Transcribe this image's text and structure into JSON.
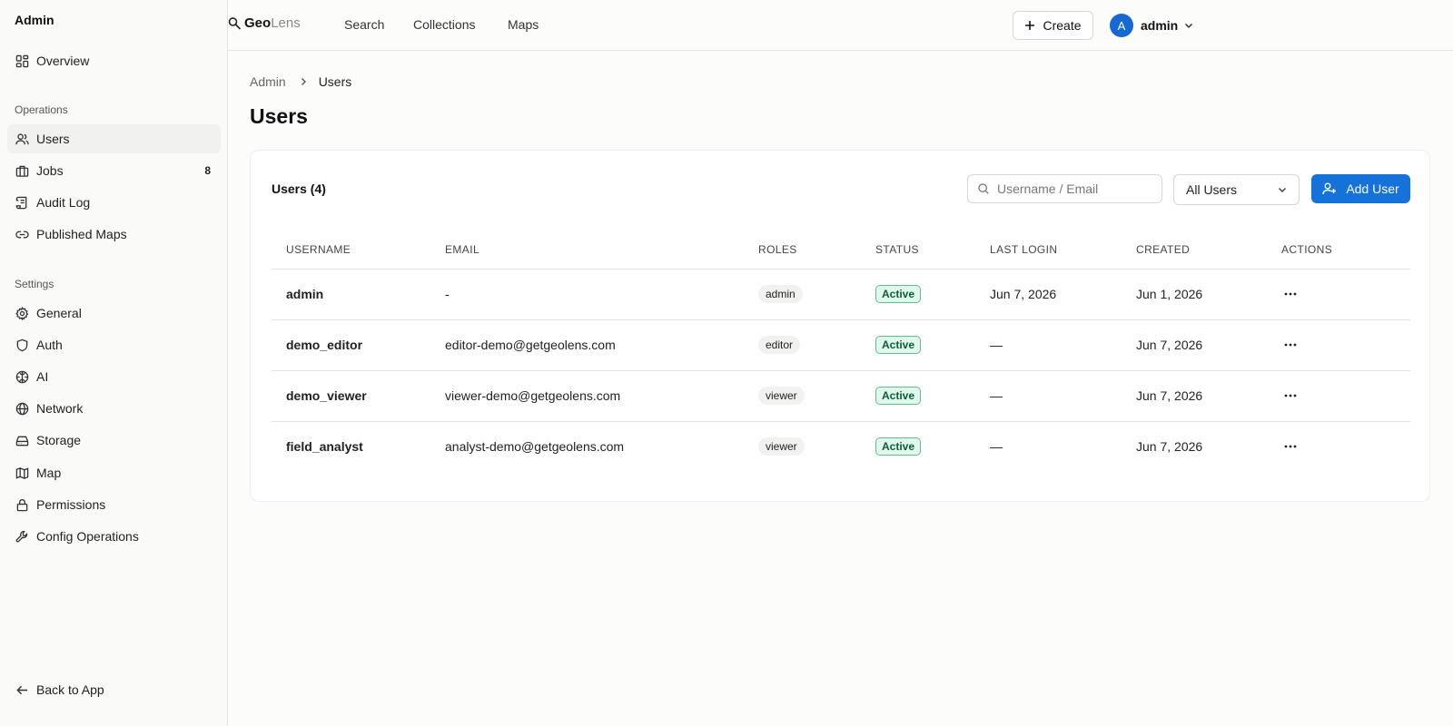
{
  "sidebar": {
    "title": "Admin",
    "overview": "Overview",
    "sections": {
      "operations": "Operations",
      "settings": "Settings"
    },
    "operations_items": [
      {
        "label": "Users",
        "icon": "users-icon",
        "active": true
      },
      {
        "label": "Jobs",
        "icon": "briefcase-icon",
        "badge": "8"
      },
      {
        "label": "Audit Log",
        "icon": "scroll-icon"
      },
      {
        "label": "Published Maps",
        "icon": "link-icon"
      }
    ],
    "settings_items": [
      {
        "label": "General",
        "icon": "gear-icon"
      },
      {
        "label": "Auth",
        "icon": "shield-icon"
      },
      {
        "label": "AI",
        "icon": "brain-icon"
      },
      {
        "label": "Network",
        "icon": "globe-icon"
      },
      {
        "label": "Storage",
        "icon": "hard-drive-icon"
      },
      {
        "label": "Map",
        "icon": "map-icon"
      },
      {
        "label": "Permissions",
        "icon": "lock-icon"
      },
      {
        "label": "Config Operations",
        "icon": "wrench-icon"
      }
    ],
    "back_label": "Back to App"
  },
  "topbar": {
    "logo_bold": "Geo",
    "logo_light": "Lens",
    "nav": [
      "Search",
      "Collections",
      "Maps"
    ],
    "create_label": "Create",
    "avatar_letter": "A",
    "user_name": "admin"
  },
  "breadcrumb": {
    "parent": "Admin",
    "current": "Users"
  },
  "page_title": "Users",
  "card": {
    "title": "Users (4)",
    "search_placeholder": "Username / Email",
    "filter_value": "All Users",
    "add_label": "Add User"
  },
  "table": {
    "headers": [
      "USERNAME",
      "EMAIL",
      "ROLES",
      "STATUS",
      "LAST LOGIN",
      "CREATED",
      "ACTIONS"
    ],
    "rows": [
      {
        "username": "admin",
        "email": "-",
        "role": "admin",
        "status": "Active",
        "last_login": "Jun 7, 2026",
        "created": "Jun 1, 2026"
      },
      {
        "username": "demo_editor",
        "email": "editor-demo@getgeolens.com",
        "role": "editor",
        "status": "Active",
        "last_login": "—",
        "created": "Jun 7, 2026"
      },
      {
        "username": "demo_viewer",
        "email": "viewer-demo@getgeolens.com",
        "role": "viewer",
        "status": "Active",
        "last_login": "—",
        "created": "Jun 7, 2026"
      },
      {
        "username": "field_analyst",
        "email": "analyst-demo@getgeolens.com",
        "role": "viewer",
        "status": "Active",
        "last_login": "—",
        "created": "Jun 7, 2026"
      }
    ]
  },
  "colors": {
    "accent": "#1472d8",
    "avatar": "#1669d3",
    "status_bg": "#e1f7ec",
    "status_border": "#5dbf8e"
  }
}
